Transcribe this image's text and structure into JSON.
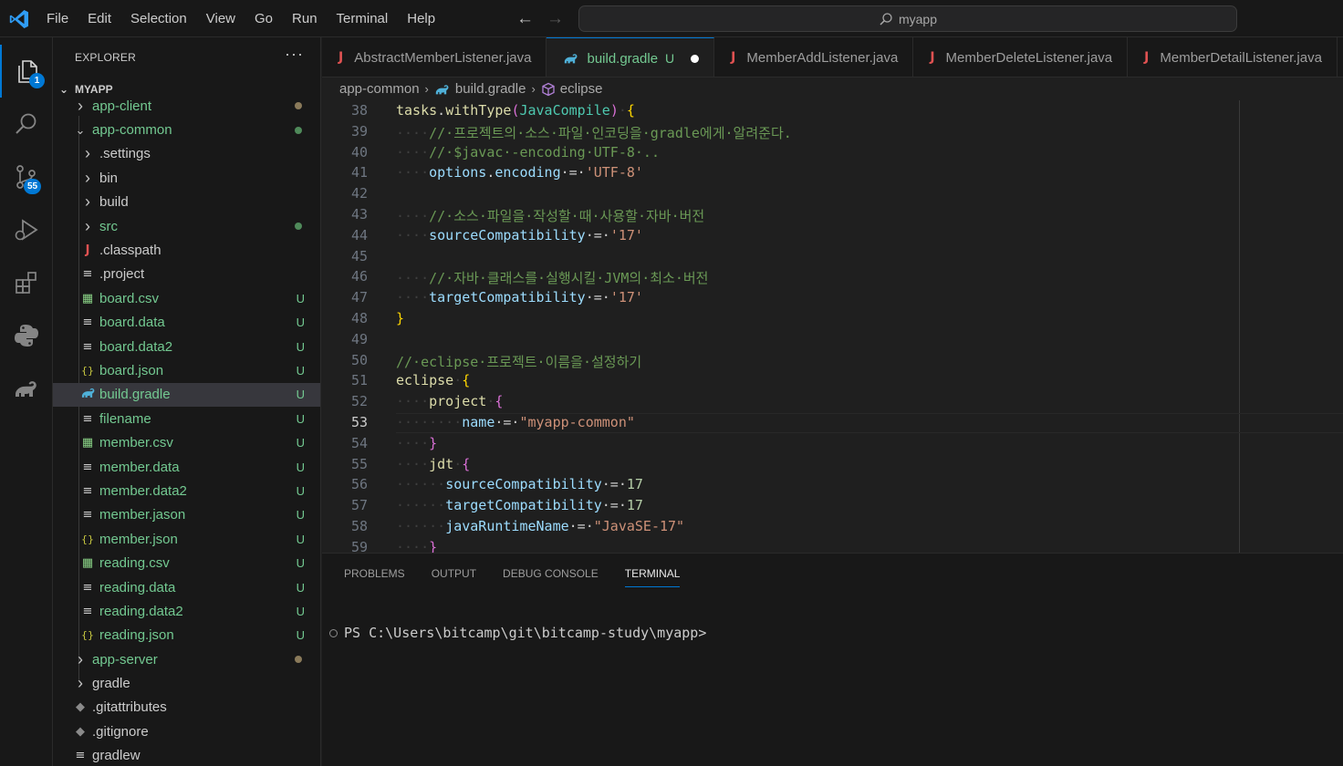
{
  "titlebar": {
    "menu": [
      "File",
      "Edit",
      "Selection",
      "View",
      "Go",
      "Run",
      "Terminal",
      "Help"
    ],
    "search_text": "myapp"
  },
  "activity_bar": {
    "explorer_badge": "1",
    "source_control_badge": "55"
  },
  "sidebar": {
    "header": "EXPLORER",
    "more": "···",
    "project": "MYAPP",
    "items": [
      {
        "label": "app-client",
        "kind": "folder",
        "indent": 1,
        "expanded": false,
        "color": "#73c991",
        "decoration": "dot",
        "decoration_color": "#8a7a5a"
      },
      {
        "label": "app-common",
        "kind": "folder",
        "indent": 1,
        "expanded": true,
        "color": "#73c991",
        "decoration": "dot",
        "decoration_color": "#4f8a5a"
      },
      {
        "label": ".settings",
        "kind": "folder",
        "indent": 2,
        "expanded": false,
        "color": "#cccccc"
      },
      {
        "label": "bin",
        "kind": "folder",
        "indent": 2,
        "expanded": false,
        "color": "#cccccc"
      },
      {
        "label": "build",
        "kind": "folder",
        "indent": 2,
        "expanded": false,
        "color": "#cccccc"
      },
      {
        "label": "src",
        "kind": "folder",
        "indent": 2,
        "expanded": false,
        "color": "#73c991",
        "decoration": "dot",
        "decoration_color": "#4f8a5a"
      },
      {
        "label": ".classpath",
        "kind": "java",
        "indent": 2,
        "color": "#cccccc"
      },
      {
        "label": ".project",
        "kind": "lines",
        "indent": 2,
        "color": "#cccccc"
      },
      {
        "label": "board.csv",
        "kind": "csv",
        "indent": 2,
        "color": "#73c991",
        "status": "U"
      },
      {
        "label": "board.data",
        "kind": "lines",
        "indent": 2,
        "color": "#73c991",
        "status": "U"
      },
      {
        "label": "board.data2",
        "kind": "lines",
        "indent": 2,
        "color": "#73c991",
        "status": "U"
      },
      {
        "label": "board.json",
        "kind": "json",
        "indent": 2,
        "color": "#73c991",
        "status": "U"
      },
      {
        "label": "build.gradle",
        "kind": "gradle",
        "indent": 2,
        "color": "#73c991",
        "status": "U",
        "selected": true
      },
      {
        "label": "filename",
        "kind": "lines",
        "indent": 2,
        "color": "#73c991",
        "status": "U"
      },
      {
        "label": "member.csv",
        "kind": "csv",
        "indent": 2,
        "color": "#73c991",
        "status": "U"
      },
      {
        "label": "member.data",
        "kind": "lines",
        "indent": 2,
        "color": "#73c991",
        "status": "U"
      },
      {
        "label": "member.data2",
        "kind": "lines",
        "indent": 2,
        "color": "#73c991",
        "status": "U"
      },
      {
        "label": "member.jason",
        "kind": "lines",
        "indent": 2,
        "color": "#73c991",
        "status": "U"
      },
      {
        "label": "member.json",
        "kind": "json",
        "indent": 2,
        "color": "#73c991",
        "status": "U"
      },
      {
        "label": "reading.csv",
        "kind": "csv",
        "indent": 2,
        "color": "#73c991",
        "status": "U"
      },
      {
        "label": "reading.data",
        "kind": "lines",
        "indent": 2,
        "color": "#73c991",
        "status": "U"
      },
      {
        "label": "reading.data2",
        "kind": "lines",
        "indent": 2,
        "color": "#73c991",
        "status": "U"
      },
      {
        "label": "reading.json",
        "kind": "json",
        "indent": 2,
        "color": "#73c991",
        "status": "U"
      },
      {
        "label": "app-server",
        "kind": "folder",
        "indent": 1,
        "expanded": false,
        "color": "#73c991",
        "decoration": "dot",
        "decoration_color": "#8a7a5a"
      },
      {
        "label": "gradle",
        "kind": "folder",
        "indent": 1,
        "expanded": false,
        "color": "#cccccc"
      },
      {
        "label": ".gitattributes",
        "kind": "git",
        "indent": 1,
        "color": "#cccccc"
      },
      {
        "label": ".gitignore",
        "kind": "git",
        "indent": 1,
        "color": "#cccccc"
      },
      {
        "label": "gradlew",
        "kind": "lines",
        "indent": 1,
        "color": "#cccccc"
      }
    ]
  },
  "tabs": [
    {
      "label": "AbstractMemberListener.java",
      "kind": "java"
    },
    {
      "label": "build.gradle",
      "kind": "gradle",
      "active": true,
      "modified": "U"
    },
    {
      "label": "MemberAddListener.java",
      "kind": "java"
    },
    {
      "label": "MemberDeleteListener.java",
      "kind": "java"
    },
    {
      "label": "MemberDetailListener.java",
      "kind": "java"
    }
  ],
  "breadcrumbs": {
    "folder": "app-common",
    "file": "build.gradle",
    "symbol": "eclipse"
  },
  "editor": {
    "current_line": "53",
    "lines": [
      {
        "n": "38",
        "tokens": [
          [
            "tasks",
            "kw"
          ],
          [
            ".",
            "plain"
          ],
          [
            "withType",
            "kw"
          ],
          [
            "(",
            "b2"
          ],
          [
            "JavaCompile",
            "fn"
          ],
          [
            ")",
            "b2"
          ],
          [
            "·",
            "ws"
          ],
          [
            "{",
            "b1"
          ]
        ]
      },
      {
        "n": "39",
        "tokens": [
          [
            "····",
            "ws"
          ],
          [
            "//·프로젝트의·소스·파일·인코딩을·gradle에게·알려준다.",
            "cm"
          ]
        ]
      },
      {
        "n": "40",
        "tokens": [
          [
            "····",
            "ws"
          ],
          [
            "//·$javac·-encoding·UTF-8·..",
            "cm"
          ]
        ]
      },
      {
        "n": "41",
        "tokens": [
          [
            "····",
            "ws"
          ],
          [
            "options",
            "prop"
          ],
          [
            ".",
            "plain"
          ],
          [
            "encoding",
            "prop"
          ],
          [
            "·=·",
            "plain"
          ],
          [
            "'UTF-8'",
            "str"
          ]
        ]
      },
      {
        "n": "42",
        "tokens": []
      },
      {
        "n": "43",
        "tokens": [
          [
            "····",
            "ws"
          ],
          [
            "//·소스·파일을·작성할·때·사용할·자바·버전",
            "cm"
          ]
        ]
      },
      {
        "n": "44",
        "tokens": [
          [
            "····",
            "ws"
          ],
          [
            "sourceCompatibility",
            "prop"
          ],
          [
            "·=·",
            "plain"
          ],
          [
            "'17'",
            "str"
          ]
        ]
      },
      {
        "n": "45",
        "tokens": []
      },
      {
        "n": "46",
        "tokens": [
          [
            "····",
            "ws"
          ],
          [
            "//·자바·클래스를·실행시킬·JVM의·최소·버전",
            "cm"
          ]
        ]
      },
      {
        "n": "47",
        "tokens": [
          [
            "····",
            "ws"
          ],
          [
            "targetCompatibility",
            "prop"
          ],
          [
            "·=·",
            "plain"
          ],
          [
            "'17'",
            "str"
          ]
        ]
      },
      {
        "n": "48",
        "tokens": [
          [
            "}",
            "b1"
          ]
        ]
      },
      {
        "n": "49",
        "tokens": []
      },
      {
        "n": "50",
        "tokens": [
          [
            "//·eclipse·프로젝트·이름을·설정하기",
            "cm"
          ]
        ]
      },
      {
        "n": "51",
        "tokens": [
          [
            "eclipse",
            "kw"
          ],
          [
            "·",
            "ws"
          ],
          [
            "{",
            "b1"
          ]
        ]
      },
      {
        "n": "52",
        "tokens": [
          [
            "····",
            "ws"
          ],
          [
            "project",
            "kw"
          ],
          [
            "·",
            "ws"
          ],
          [
            "{",
            "b2"
          ]
        ]
      },
      {
        "n": "53",
        "tokens": [
          [
            "········",
            "ws"
          ],
          [
            "name",
            "prop"
          ],
          [
            "·=·",
            "plain"
          ],
          [
            "\"myapp-common\"",
            "str"
          ]
        ]
      },
      {
        "n": "54",
        "tokens": [
          [
            "····",
            "ws"
          ],
          [
            "}",
            "b2"
          ]
        ]
      },
      {
        "n": "55",
        "tokens": [
          [
            "····",
            "ws"
          ],
          [
            "jdt",
            "kw"
          ],
          [
            "·",
            "ws"
          ],
          [
            "{",
            "b2"
          ]
        ]
      },
      {
        "n": "56",
        "tokens": [
          [
            "······",
            "ws"
          ],
          [
            "sourceCompatibility",
            "prop"
          ],
          [
            "·=·",
            "plain"
          ],
          [
            "17",
            "num"
          ]
        ]
      },
      {
        "n": "57",
        "tokens": [
          [
            "······",
            "ws"
          ],
          [
            "targetCompatibility",
            "prop"
          ],
          [
            "·=·",
            "plain"
          ],
          [
            "17",
            "num"
          ]
        ]
      },
      {
        "n": "58",
        "tokens": [
          [
            "······",
            "ws"
          ],
          [
            "javaRuntimeName",
            "prop"
          ],
          [
            "·=·",
            "plain"
          ],
          [
            "\"JavaSE-17\"",
            "str"
          ]
        ]
      },
      {
        "n": "59",
        "tokens": [
          [
            "····",
            "ws"
          ],
          [
            "}",
            "b2"
          ]
        ]
      }
    ]
  },
  "panel": {
    "tabs": [
      "PROBLEMS",
      "OUTPUT",
      "DEBUG CONSOLE",
      "TERMINAL"
    ],
    "active_tab": "TERMINAL",
    "prompt": "PS C:\\Users\\bitcamp\\git\\bitcamp-study\\myapp>"
  },
  "colors": {
    "accent": "#0078d4",
    "untracked": "#73c991",
    "java_icon": "#e05252"
  }
}
